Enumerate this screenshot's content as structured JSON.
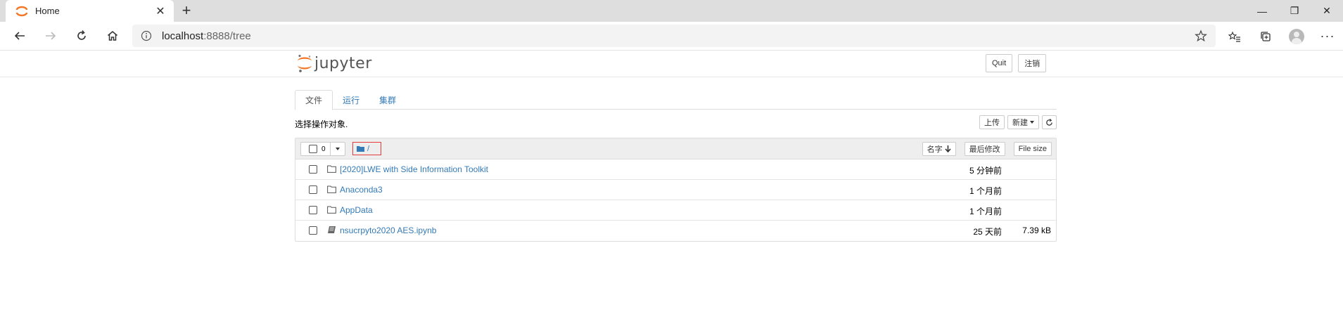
{
  "browser": {
    "tab_title": "Home",
    "url_host": "localhost",
    "url_path": ":8888/tree"
  },
  "jupyter": {
    "logo_text": "jupyter",
    "header_buttons": {
      "quit": "Quit",
      "logout": "注销"
    },
    "tabs": [
      {
        "label": "文件",
        "active": true
      },
      {
        "label": "运行",
        "active": false
      },
      {
        "label": "集群",
        "active": false
      }
    ],
    "hint": "选择操作对象.",
    "tools": {
      "upload": "上传",
      "new": "新建"
    },
    "list": {
      "select_count": "0",
      "breadcrumb": "/",
      "sort_name": "名字",
      "sort_modified": "最后修改",
      "sort_size": "File size",
      "items": [
        {
          "type": "folder",
          "name": "[2020]LWE with Side Information Toolkit",
          "modified": "5 分钟前",
          "size": ""
        },
        {
          "type": "folder",
          "name": "Anaconda3",
          "modified": "1 个月前",
          "size": ""
        },
        {
          "type": "folder",
          "name": "AppData",
          "modified": "1 个月前",
          "size": ""
        },
        {
          "type": "notebook",
          "name": "nsucrpyto2020 AES.ipynb",
          "modified": "25 天前",
          "size": "7.39 kB"
        }
      ]
    }
  },
  "colors": {
    "link": "#337ab7",
    "jupyter_orange": "#f37726",
    "crumb_border": "#e23c3c"
  }
}
